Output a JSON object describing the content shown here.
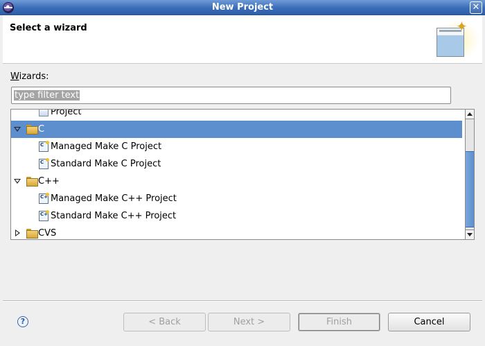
{
  "window": {
    "title": "New Project"
  },
  "header": {
    "title": "Select a wizard"
  },
  "wizards_label": {
    "mnemonic": "W",
    "rest": "izards:"
  },
  "filter": {
    "text": "type filter text"
  },
  "tree": {
    "items": [
      {
        "label": "Project",
        "level": 1,
        "icon": "project-icon",
        "twisty": "none",
        "selected": false
      },
      {
        "label": "C",
        "level": 0,
        "icon": "folder-icon",
        "twisty": "expanded",
        "selected": true
      },
      {
        "label": "Managed Make C Project",
        "level": 1,
        "icon": "c-project-icon",
        "icon_text": "C",
        "twisty": "none",
        "selected": false
      },
      {
        "label": "Standard Make C Project",
        "level": 1,
        "icon": "c-project-icon",
        "icon_text": "C",
        "twisty": "none",
        "selected": false
      },
      {
        "label": "C++",
        "level": 0,
        "icon": "folder-icon",
        "twisty": "expanded",
        "selected": false
      },
      {
        "label": "Managed Make C++ Project",
        "level": 1,
        "icon": "cpp-project-icon",
        "icon_text": "C+",
        "twisty": "none",
        "selected": false
      },
      {
        "label": "Standard Make C++ Project",
        "level": 1,
        "icon": "cpp-project-icon",
        "icon_text": "C+",
        "twisty": "none",
        "selected": false
      },
      {
        "label": "CVS",
        "level": 0,
        "icon": "folder-icon",
        "twisty": "collapsed",
        "selected": false
      }
    ]
  },
  "buttons": {
    "back": "< Back",
    "next": "Next >",
    "finish": "Finish",
    "cancel": "Cancel"
  },
  "help": {
    "glyph": "?"
  },
  "colors": {
    "selection": "#5d8ecd",
    "titlebar": "#3a6db8"
  }
}
